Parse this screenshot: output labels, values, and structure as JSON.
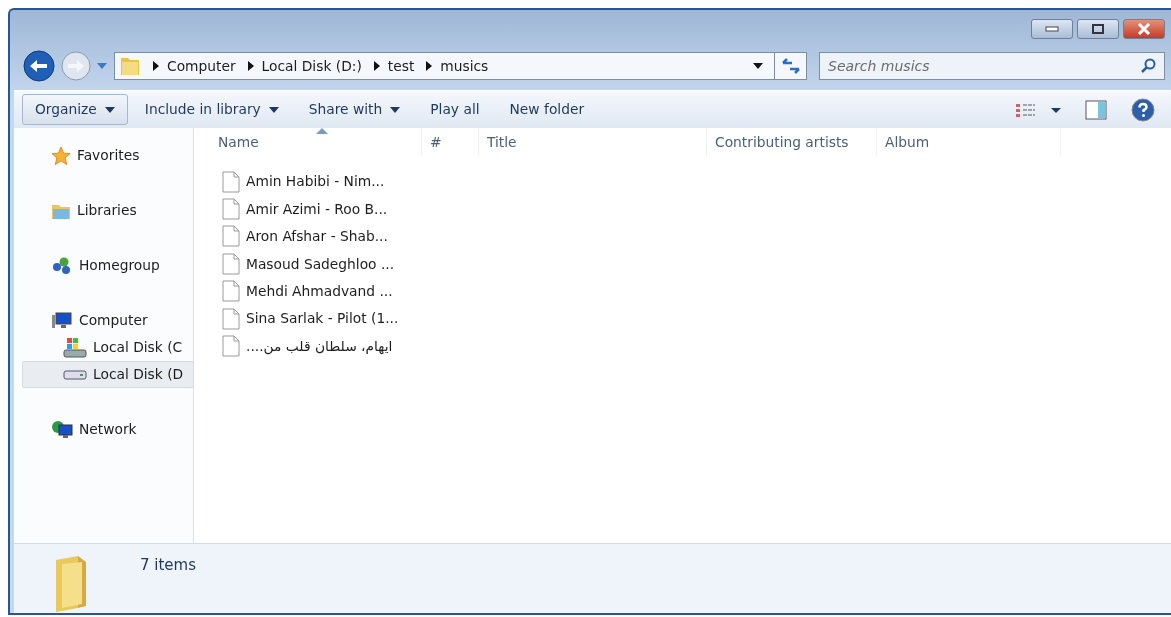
{
  "address": {
    "crumbs": [
      "Computer",
      "Local Disk (D:)",
      "test",
      "musics"
    ]
  },
  "search": {
    "placeholder": "Search musics"
  },
  "toolbar": [
    {
      "label": "Organize",
      "dropdown": true,
      "selected": true
    },
    {
      "label": "Include in library",
      "dropdown": true,
      "selected": false
    },
    {
      "label": "Share with",
      "dropdown": true,
      "selected": false
    },
    {
      "label": "Play all",
      "dropdown": false,
      "selected": false
    },
    {
      "label": "New folder",
      "dropdown": false,
      "selected": false
    }
  ],
  "sidebar": {
    "items": [
      {
        "label": "Favorites",
        "kind": "favorites",
        "selected": false
      },
      {
        "label": "Libraries",
        "kind": "libraries",
        "selected": false
      },
      {
        "label": "Homegroup",
        "kind": "homegroup",
        "selected": false
      },
      {
        "label": "Computer",
        "kind": "computer",
        "selected": false,
        "children": [
          {
            "label": "Local Disk (C",
            "kind": "system-drive",
            "selected": false
          },
          {
            "label": "Local Disk (D",
            "kind": "drive",
            "selected": true
          }
        ]
      },
      {
        "label": "Network",
        "kind": "network",
        "selected": false
      }
    ]
  },
  "table": {
    "columns": [
      {
        "label": "Name",
        "sorted": true
      },
      {
        "label": "#",
        "sorted": false
      },
      {
        "label": "Title",
        "sorted": false
      },
      {
        "label": "Contributing artists",
        "sorted": false
      },
      {
        "label": "Album",
        "sorted": false
      }
    ],
    "rows": [
      {
        "name": "Amin Habibi - Nim..."
      },
      {
        "name": "Amir Azimi - Roo B..."
      },
      {
        "name": "Aron Afshar - Shab..."
      },
      {
        "name": "Masoud Sadeghloo ..."
      },
      {
        "name": "Mehdi Ahmadvand ..."
      },
      {
        "name": "Sina Sarlak - Pilot (1..."
      },
      {
        "name": "ايهام، سلطان قلب من...."
      }
    ]
  },
  "status_bar": {
    "count": "7 items"
  }
}
